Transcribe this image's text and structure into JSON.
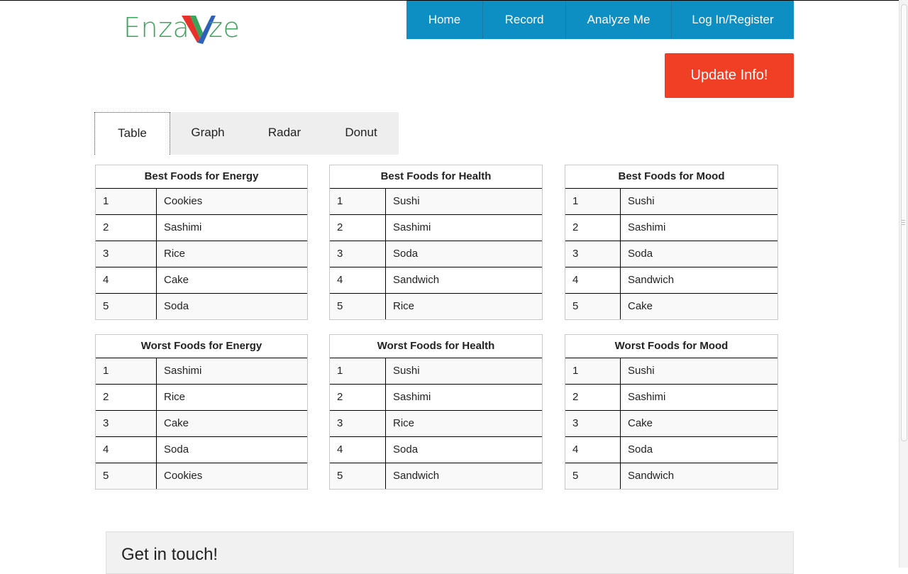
{
  "brand": {
    "logo_left": "Enza",
    "logo_right": "ze",
    "logo_accent_red": "#e8312a",
    "logo_accent_blue": "#2e62b8",
    "logo_green": "#3aa55a"
  },
  "nav": {
    "items": [
      {
        "label": "Home"
      },
      {
        "label": "Record"
      },
      {
        "label": "Analyze Me"
      },
      {
        "label": "Log In/Register"
      }
    ],
    "color": "#0e8fc4"
  },
  "update_button": {
    "label": "Update Info!",
    "color": "#f13f25"
  },
  "tabs": {
    "items": [
      {
        "label": "Table"
      },
      {
        "label": "Graph"
      },
      {
        "label": "Radar"
      },
      {
        "label": "Donut"
      }
    ],
    "active": "Table"
  },
  "tables": [
    {
      "title": "Best Foods for Energy",
      "rows": [
        {
          "rank": "1",
          "food": "Cookies"
        },
        {
          "rank": "2",
          "food": "Sashimi"
        },
        {
          "rank": "3",
          "food": "Rice"
        },
        {
          "rank": "4",
          "food": "Cake"
        },
        {
          "rank": "5",
          "food": "Soda"
        }
      ]
    },
    {
      "title": "Best Foods for Health",
      "rows": [
        {
          "rank": "1",
          "food": "Sushi"
        },
        {
          "rank": "2",
          "food": "Sashimi"
        },
        {
          "rank": "3",
          "food": "Soda"
        },
        {
          "rank": "4",
          "food": "Sandwich"
        },
        {
          "rank": "5",
          "food": "Rice"
        }
      ]
    },
    {
      "title": "Best Foods for Mood",
      "rows": [
        {
          "rank": "1",
          "food": "Sushi"
        },
        {
          "rank": "2",
          "food": "Sashimi"
        },
        {
          "rank": "3",
          "food": "Soda"
        },
        {
          "rank": "4",
          "food": "Sandwich"
        },
        {
          "rank": "5",
          "food": "Cake"
        }
      ]
    },
    {
      "title": "Worst Foods for Energy",
      "rows": [
        {
          "rank": "1",
          "food": "Sashimi"
        },
        {
          "rank": "2",
          "food": "Rice"
        },
        {
          "rank": "3",
          "food": "Cake"
        },
        {
          "rank": "4",
          "food": "Soda"
        },
        {
          "rank": "5",
          "food": "Cookies"
        }
      ]
    },
    {
      "title": "Worst Foods for Health",
      "rows": [
        {
          "rank": "1",
          "food": "Sushi"
        },
        {
          "rank": "2",
          "food": "Sashimi"
        },
        {
          "rank": "3",
          "food": "Rice"
        },
        {
          "rank": "4",
          "food": "Soda"
        },
        {
          "rank": "5",
          "food": "Sandwich"
        }
      ]
    },
    {
      "title": "Worst Foods for Mood",
      "rows": [
        {
          "rank": "1",
          "food": "Sushi"
        },
        {
          "rank": "2",
          "food": "Sashimi"
        },
        {
          "rank": "3",
          "food": "Cake"
        },
        {
          "rank": "4",
          "food": "Soda"
        },
        {
          "rank": "5",
          "food": "Sandwich"
        }
      ]
    }
  ],
  "footer": {
    "heading": "Get in touch!"
  }
}
